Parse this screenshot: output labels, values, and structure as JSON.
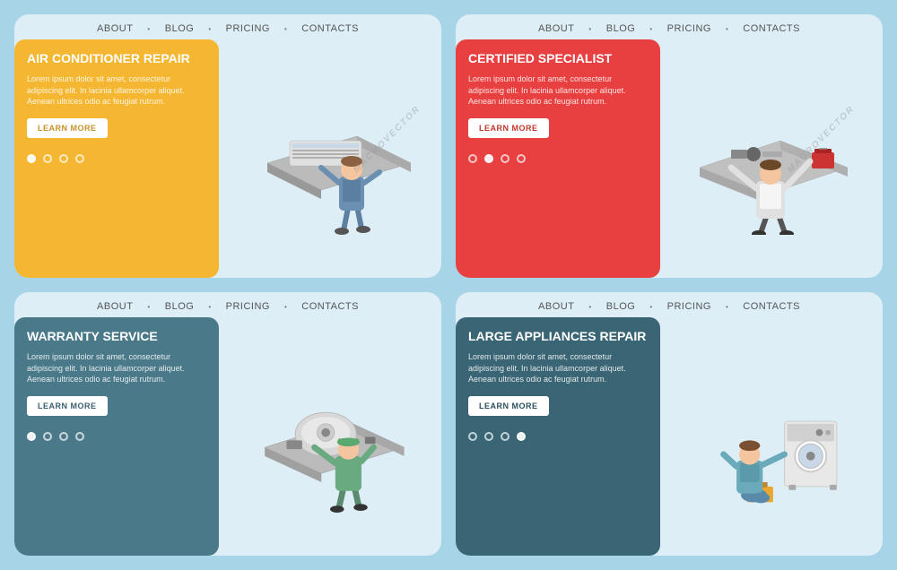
{
  "cards": [
    {
      "id": "air-conditioner",
      "variant": "yellow",
      "nav": [
        "ABOUT",
        "BLOG",
        "PRICING",
        "CONTACTS"
      ],
      "title": "AIR CONDITIONER REPAIR",
      "description": "Lorem ipsum dolor sit amet, consectetur adipiscing elit. In lacinia ullamcorper aliquet. Aenean ultrices odio ac feugiat rutrum.",
      "button_label": "LEARN MORE",
      "dots": [
        true,
        false,
        false,
        false
      ],
      "figure": "air-conditioner-repair"
    },
    {
      "id": "certified-specialist",
      "variant": "red",
      "nav": [
        "ABOUT",
        "BLOG",
        "PRICING",
        "CONTACTS"
      ],
      "title": "CERTIFIED SPECIALIST",
      "description": "Lorem ipsum dolor sit amet, consectetur adipiscing elit. In lacinia ullamcorper aliquet. Aenean ultrices odio ac feugiat rutrum.",
      "button_label": "LEARN MORE",
      "dots": [
        false,
        true,
        false,
        false
      ],
      "figure": "certified-specialist"
    },
    {
      "id": "warranty-service",
      "variant": "steelblue",
      "nav": [
        "ABOUT",
        "BLOG",
        "PRICING",
        "CONTACTS"
      ],
      "title": "WARRANTY SERVICE",
      "description": "Lorem ipsum dolor sit amet, consectetur adipiscing elit. In lacinia ullamcorper aliquet. Aenean ultrices odio ac feugiat rutrum.",
      "button_label": "LEARN MORE",
      "dots": [
        true,
        false,
        false,
        false
      ],
      "figure": "warranty-service"
    },
    {
      "id": "large-appliances",
      "variant": "darkblue",
      "nav": [
        "ABOUT",
        "BLOG",
        "PRICING",
        "CONTACTS"
      ],
      "title": "LARGE APPLIANCES REPAIR",
      "description": "Lorem ipsum dolor sit amet, consectetur adipiscing elit. In lacinia ullamcorper aliquet. Aenean ultrices odio ac feugiat rutrum.",
      "button_label": "LEARN MORE",
      "dots": [
        false,
        false,
        false,
        true
      ],
      "figure": "large-appliances-repair"
    }
  ],
  "colors": {
    "yellow": "#f5b731",
    "red": "#e84040",
    "steelblue": "#4a7a8a",
    "darkblue": "#3a6575",
    "background": "#a8d4e8"
  }
}
